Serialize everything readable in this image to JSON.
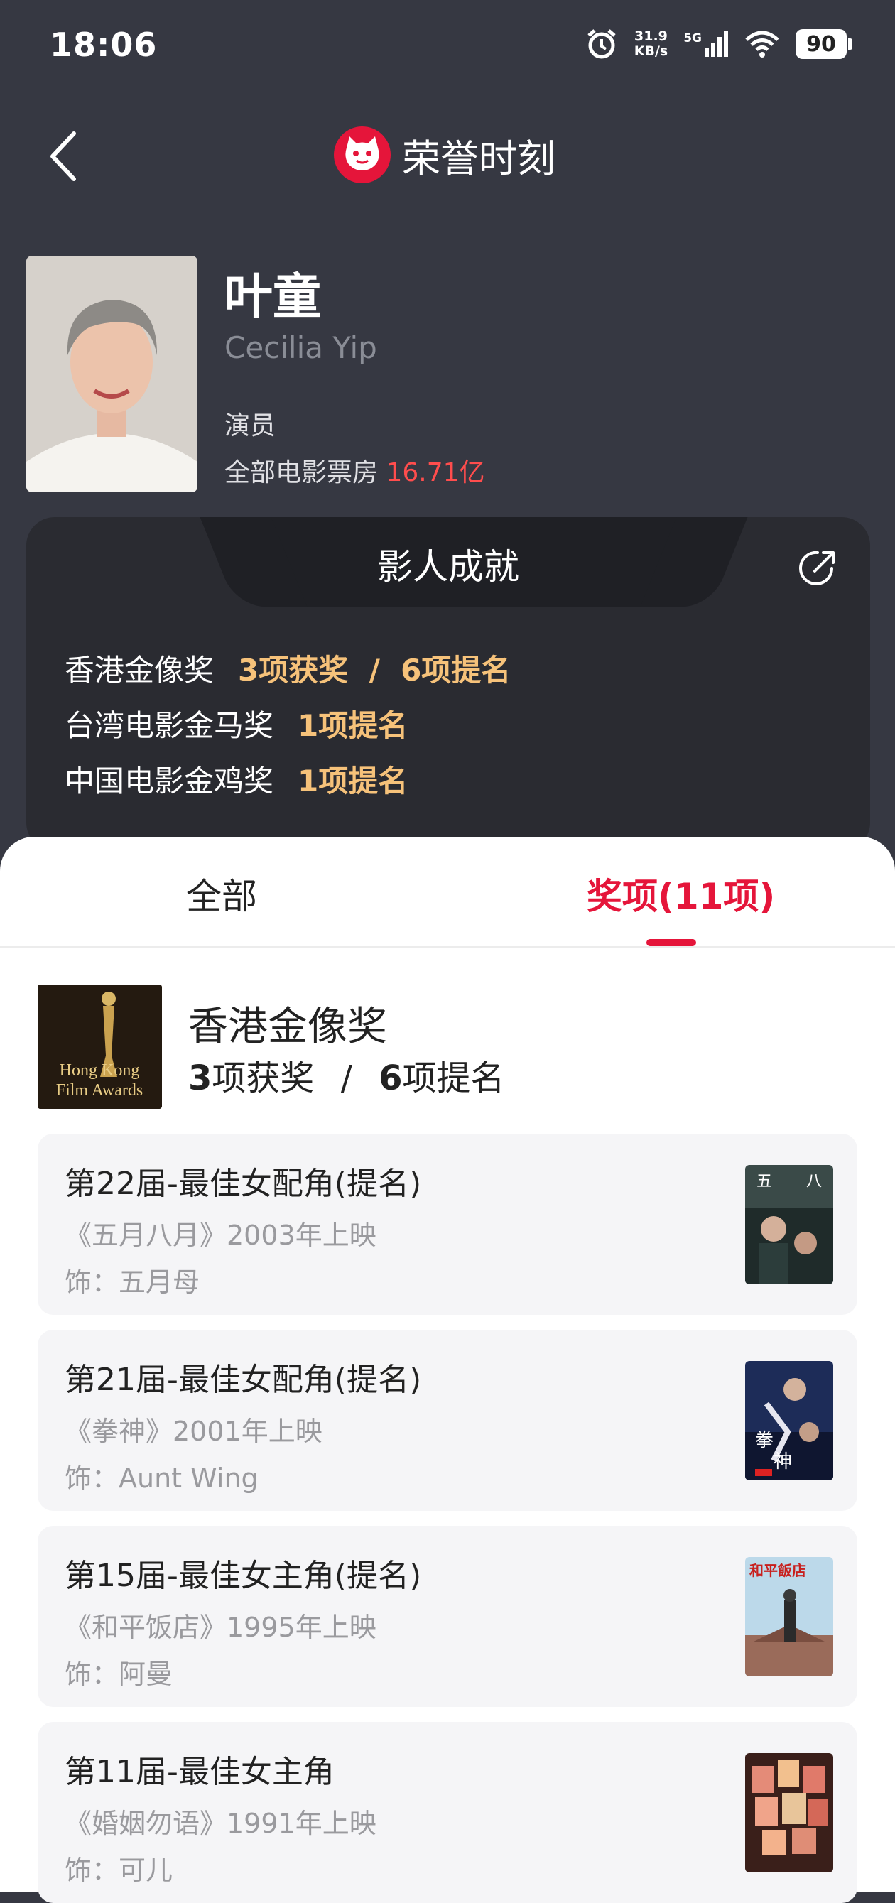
{
  "status": {
    "time": "18:06",
    "net_speed_value": "31.9",
    "net_speed_unit": "KB/s",
    "network": "5G",
    "battery": "90"
  },
  "header": {
    "title": "荣誉时刻"
  },
  "profile": {
    "name": "叶童",
    "english_name": "Cecilia Yip",
    "role": "演员",
    "box_office_label": "全部电影票房",
    "box_office_value": "16.71亿"
  },
  "achievements": {
    "title": "影人成就",
    "rows": [
      {
        "award": "香港金像奖",
        "detail": "3项获奖  /  6项提名"
      },
      {
        "award": "台湾电影金马奖",
        "detail": "1项提名"
      },
      {
        "award": "中国电影金鸡奖",
        "detail": "1项提名"
      }
    ]
  },
  "tabs": {
    "all": "全部",
    "awards": "奖项(11项)"
  },
  "award_group": {
    "name": "香港金像奖",
    "wins_num": "3",
    "wins_label": "项获奖",
    "sep": "/",
    "noms_num": "6",
    "noms_label": "项提名",
    "logo_text_1": "Hong Kong",
    "logo_text_2": "Film Awards"
  },
  "items": [
    {
      "title": "第22届-最佳女配角(提名)",
      "film": "《五月八月》2003年上映",
      "role": "饰：五月母"
    },
    {
      "title": "第21届-最佳女配角(提名)",
      "film": "《拳神》2001年上映",
      "role": "饰：Aunt Wing"
    },
    {
      "title": "第15届-最佳女主角(提名)",
      "film": "《和平饭店》1995年上映",
      "role": "饰：阿曼"
    },
    {
      "title": "第11届-最佳女主角",
      "film": "《婚姻勿语》1991年上映",
      "role": "饰：可儿"
    }
  ],
  "colors": {
    "bg_dark": "#363842",
    "card_dark": "#2a2b31",
    "accent_red": "#e5153a",
    "gold": "#f6c27a",
    "box_office_red": "#ff4d4d"
  }
}
